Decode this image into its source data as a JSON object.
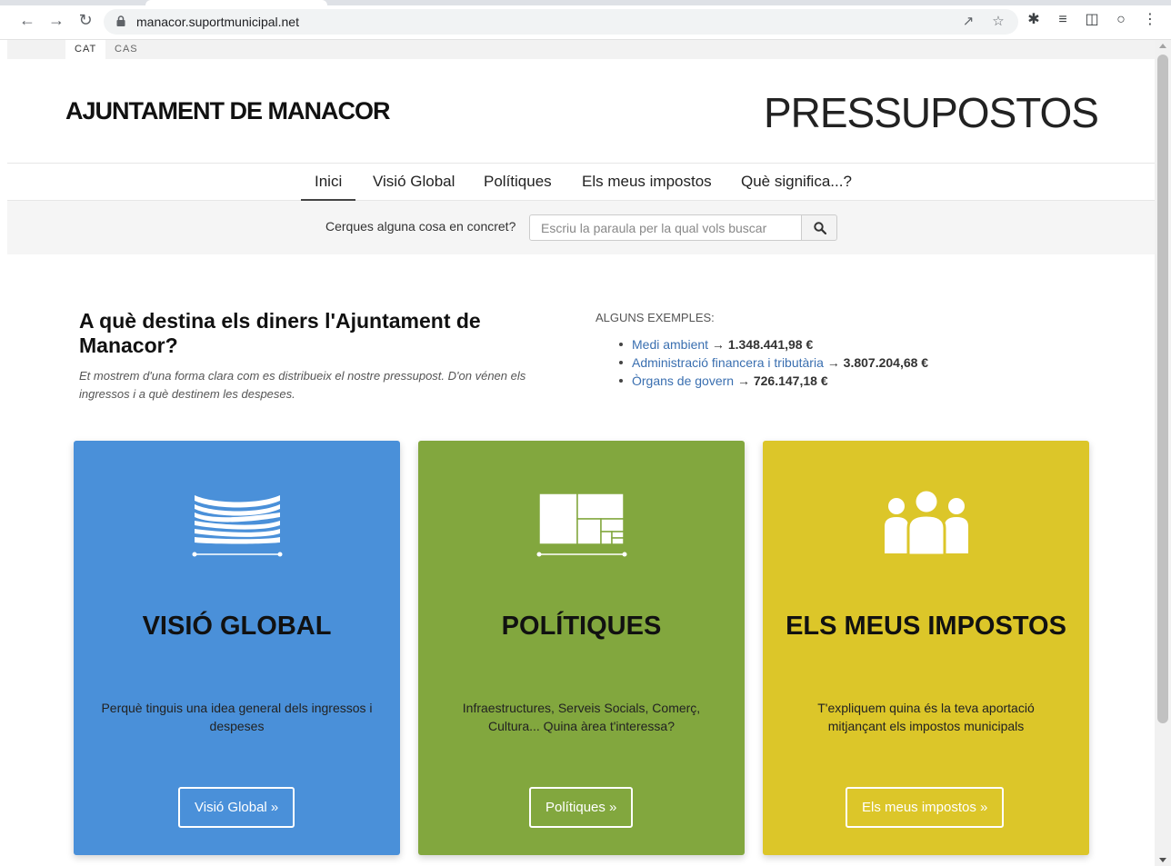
{
  "browser": {
    "url": "manacor.suportmunicipal.net"
  },
  "languages": [
    "CAT",
    "CAS"
  ],
  "header": {
    "site_title": "AJUNTAMENT DE MANACOR",
    "section_title": "PRESSUPOSTOS"
  },
  "nav": {
    "items": [
      "Inici",
      "Visió Global",
      "Polítiques",
      "Els meus impostos",
      "Què significa...?"
    ],
    "active": "Inici"
  },
  "search": {
    "label": "Cerques alguna cosa en concret?",
    "placeholder": "Escriu la paraula per la qual vols buscar"
  },
  "intro": {
    "title": "A què destina els diners l'Ajuntament de Manacor?",
    "text": "Et mostrem d'una forma clara com es distribueix el nostre pressupost. D'on vénen els ingressos i a què destinem les despeses."
  },
  "examples": {
    "heading": "ALGUNS EXEMPLES:",
    "items": [
      {
        "label": "Medi ambient",
        "arrow": " → ",
        "amount": "1.348.441,98 €"
      },
      {
        "label": "Administració financera i tributària",
        "arrow": " → ",
        "amount": "3.807.204,68 €"
      },
      {
        "label": "Òrgans de govern",
        "arrow": " → ",
        "amount": "726.147,18 €"
      }
    ]
  },
  "cards": [
    {
      "title": "VISIÓ GLOBAL",
      "description": "Perquè tinguis una idea general dels ingressos i despeses",
      "button": "Visió Global »",
      "color": "#4a90d9",
      "icon": "flow-chart-icon"
    },
    {
      "title": "POLÍTIQUES",
      "description": "Infraestructures, Serveis Socials, Comerç, Cultura... Quina àrea t'interessa?",
      "button": "Polítiques »",
      "color": "#82a73e",
      "icon": "treemap-icon"
    },
    {
      "title": "ELS MEUS IMPOSTOS",
      "description": "T'expliquem quina és la teva aportació mitjançant els impostos municipals",
      "button": "Els meus impostos »",
      "color": "#dcc629",
      "icon": "people-icon"
    }
  ]
}
